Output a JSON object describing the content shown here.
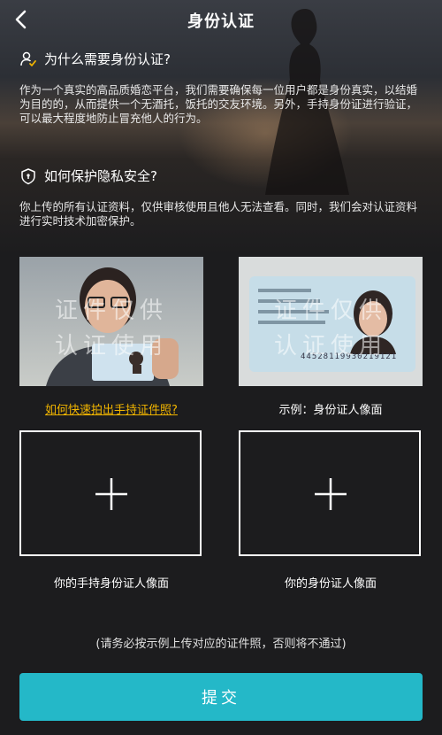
{
  "header": {
    "title": "身份认证"
  },
  "why": {
    "heading": "为什么需要身份认证?",
    "text": "作为一个真实的高品质婚恋平台，我们需要确保每一位用户都是身份真实，以结婚为目的的，从而提供一个无酒托，饭托的交友环境。另外，手持身份证进行验证，可以最大程度地防止冒充他人的行为。"
  },
  "privacy": {
    "heading": "如何保护隐私安全?",
    "text": "你上传的所有认证资料，仅供审核使用且他人无法查看。同时，我们会对认证资料进行实时技术加密保护。"
  },
  "samples": {
    "watermark_line1": "证件仅供",
    "watermark_line2": "认证使用",
    "handheld_link": "如何快速拍出手持证件照?",
    "id_caption": "示例：身份证人像面",
    "id_number": "44528119930219121"
  },
  "uploads": {
    "handheld_label": "你的手持身份证人像面",
    "id_label": "你的身份证人像面"
  },
  "note": "(请务必按示例上传对应的证件照，否则将不通过)",
  "submit_label": "提交",
  "colors": {
    "accent": "#24b8c8",
    "link": "#f0b400",
    "background": "#1c1c1e"
  }
}
